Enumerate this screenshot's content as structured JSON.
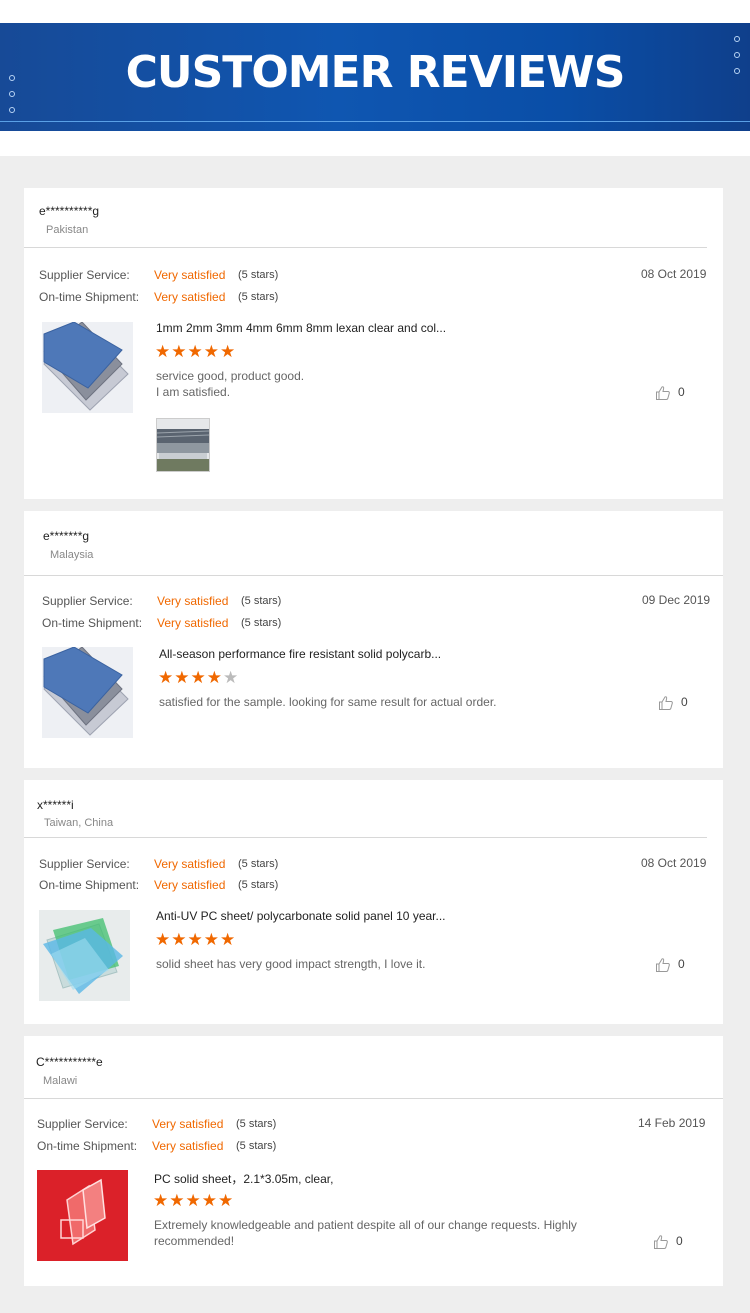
{
  "banner": {
    "title": "CUSTOMER REVIEWS"
  },
  "labels": {
    "supplier_service": "Supplier Service:",
    "ontime_shipment": "On-time Shipment:"
  },
  "reviews": [
    {
      "user": "e**********g",
      "country": "Pakistan",
      "supplier_value": "Very satisfied",
      "supplier_stars": "(5 stars)",
      "shipment_value": "Very satisfied",
      "shipment_stars": "(5 stars)",
      "date": "08 Oct 2019",
      "product_title": "1mm 2mm 3mm 4mm 6mm 8mm lexan clear and col...",
      "rating": 5,
      "comment_lines": [
        "service good, product good.",
        "I am satisfied."
      ],
      "likes": "0",
      "has_photo": true
    },
    {
      "user": "e*******g",
      "country": "Malaysia",
      "supplier_value": "Very satisfied",
      "supplier_stars": "(5 stars)",
      "shipment_value": "Very satisfied",
      "shipment_stars": "(5 stars)",
      "date": "09 Dec 2019",
      "product_title": "All-season performance fire resistant solid polycarb...",
      "rating": 4,
      "comment_lines": [
        "satisfied for the sample. looking for same result for  actual order."
      ],
      "likes": "0",
      "has_photo": false
    },
    {
      "user": "x******i",
      "country": "Taiwan, China",
      "supplier_value": "Very satisfied",
      "supplier_stars": "(5 stars)",
      "shipment_value": "Very satisfied",
      "shipment_stars": "(5 stars)",
      "date": "08 Oct 2019",
      "product_title": "Anti-UV PC sheet/ polycarbonate solid panel 10 year...",
      "rating": 5,
      "comment_lines": [
        "solid sheet has very good impact strength, I love it."
      ],
      "likes": "0",
      "has_photo": false
    },
    {
      "user": "C***********e",
      "country": "Malawi",
      "supplier_value": "Very satisfied",
      "supplier_stars": "(5 stars)",
      "shipment_value": "Very satisfied",
      "shipment_stars": "(5 stars)",
      "date": "14 Feb 2019",
      "product_title": "PC solid sheet，2.1*3.05m, clear,",
      "rating": 5,
      "comment_lines": [
        "Extremely knowledgeable and patient despite all of our change requests. Highly",
        "recommended!"
      ],
      "likes": "0",
      "has_photo": false
    }
  ],
  "colors": {
    "accent": "#f06800",
    "banner_blue": "#0f56b1",
    "background": "#eeeeee"
  },
  "icons": {
    "like": "thumbs-up-icon"
  }
}
